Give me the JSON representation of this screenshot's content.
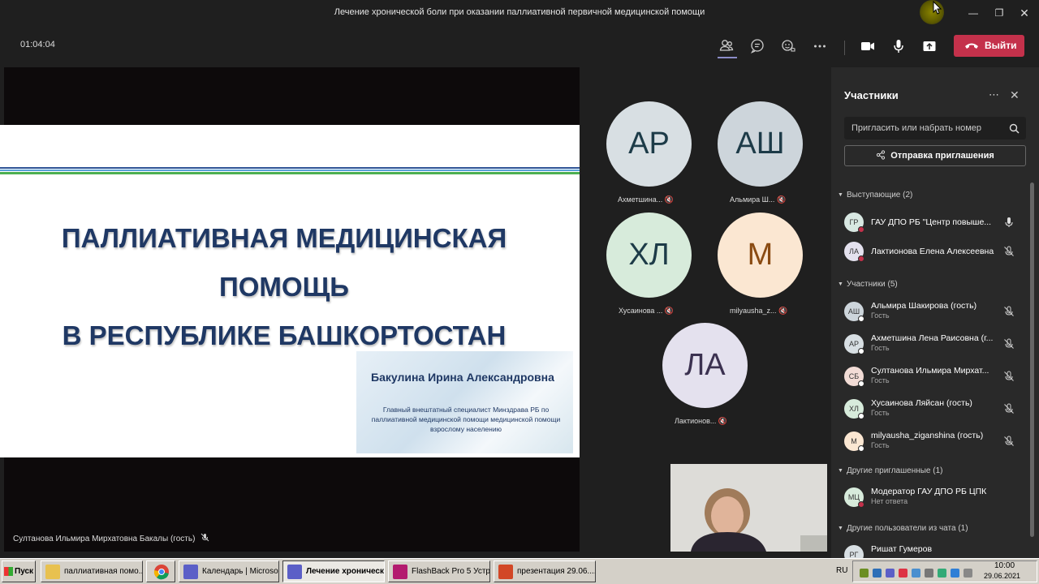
{
  "window": {
    "title": "Лечение хронической боли при оказании паллиативной первичной медицинской помощи"
  },
  "toolbar": {
    "timer": "01:04:04",
    "leave_label": "Выйти",
    "icons": [
      "people-icon",
      "chat-icon",
      "reactions-icon",
      "more-icon",
      "camera-icon",
      "mic-icon",
      "share-icon",
      "hangup-icon"
    ]
  },
  "slide": {
    "title_lines": [
      "ПАЛЛИАТИВНАЯ МЕДИЦИНСКАЯ",
      "ПОМОЩЬ",
      "В РЕСПУБЛИКЕ БАШКОРТОСТАН"
    ],
    "author": "Бакулина Ирина Александровна",
    "author_desc": "Главный внештатный специалист Минздрава РБ по паллиативной медицинской помощи медицинской помощи взрослому населению"
  },
  "presenter": "Султанова Ильмира Мирхатовна Бакалы (гость)",
  "gallery": [
    {
      "initials": "АР",
      "label": "Ахметшина...",
      "color": "#d8dfe3"
    },
    {
      "initials": "АШ",
      "label": "Альмира Ш...",
      "color": "#cdd5db"
    },
    {
      "initials": "ХЛ",
      "label": "Хусаинова ...",
      "color": "#d7ebdb"
    },
    {
      "initials": "М",
      "label": "milyausha_z...",
      "color": "#fbe7d2"
    },
    {
      "initials": "ЛА",
      "label": "Лактионов...",
      "color": "#e4e1ee"
    }
  ],
  "panel": {
    "title": "Участники",
    "search_placeholder": "Пригласить или набрать номер",
    "invite_label": "Отправка приглашения",
    "sections": {
      "presenters": "Выступающие (2)",
      "attendees": "Участники (5)",
      "others_invited": "Другие приглашенные (1)",
      "others_chat": "Другие пользователи из чата (1)"
    },
    "presenters": [
      {
        "initials": "ГР",
        "name": "ГАУ ДПО РБ \"Центр повыше...",
        "color": "#d8e8e2"
      },
      {
        "initials": "ЛА",
        "name": "Лактионова Елена Алексеевна",
        "color": "#e4e1ee"
      }
    ],
    "attendees": [
      {
        "initials": "АШ",
        "name": "Альмира Шакирова (гость)",
        "sub": "Гость",
        "color": "#cdd5db"
      },
      {
        "initials": "АР",
        "name": "Ахметшина Лена Раисовна (г...",
        "sub": "Гость",
        "color": "#d8dfe3"
      },
      {
        "initials": "СБ",
        "name": "Султанова Ильмира Мирхат...",
        "sub": "Гость",
        "color": "#f2dcd6"
      },
      {
        "initials": "ХЛ",
        "name": "Хусаинова Ляйсан (гость)",
        "sub": "Гость",
        "color": "#d7ebdb"
      },
      {
        "initials": "М",
        "name": "milyausha_ziganshina (гость)",
        "sub": "Гость",
        "color": "#fbe7d2"
      }
    ],
    "invited": [
      {
        "initials": "МЦ",
        "name": "Модератор ГАУ ДПО РБ ЦПК",
        "sub": "Нет ответа",
        "color": "#d7ebdb"
      }
    ],
    "chat_users": [
      {
        "initials": "РГ",
        "name": "Ришат Гумеров",
        "color": "#d8dfe3"
      }
    ]
  },
  "taskbar": {
    "start_label": "Пуск",
    "tasks": [
      {
        "label": "паллиативная помо..."
      },
      {
        "label": ""
      },
      {
        "label": "Календарь | Microso..."
      },
      {
        "label": "Лечение хроническ..."
      },
      {
        "label": "FlashBack Pro 5 Устр..."
      },
      {
        "label": "презентация 29.06...."
      }
    ],
    "lang": "RU",
    "time": "10:00",
    "date": "29.06.2021"
  }
}
